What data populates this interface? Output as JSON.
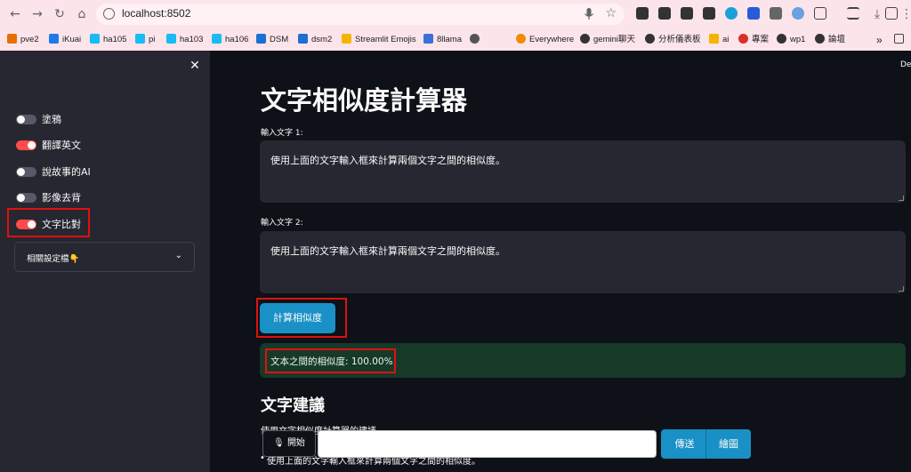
{
  "browser": {
    "url": "localhost:8502",
    "bookmarks": [
      {
        "label": "pve2",
        "color": "#e57000"
      },
      {
        "label": "iKuai",
        "color": "#1e7ae8"
      },
      {
        "label": "ha105",
        "color": "#18bcf2"
      },
      {
        "label": "pi",
        "color": "#18bcf2"
      },
      {
        "label": "ha103",
        "color": "#18bcf2"
      },
      {
        "label": "ha106",
        "color": "#18bcf2"
      },
      {
        "label": "DSM",
        "color": "#1c6fd4"
      },
      {
        "label": "dsm2",
        "color": "#1c6fd4"
      },
      {
        "label": "Streamlit Emojis",
        "color": "#f5b400"
      },
      {
        "label": "8llama",
        "color": "#3b6fd9"
      },
      {
        "label": "",
        "color": "#555555"
      },
      {
        "label": "Everywhere",
        "color": "#f28b00"
      },
      {
        "label": "gemini聊天",
        "color": "#333333"
      },
      {
        "label": "分析儀表板",
        "color": "#333333"
      },
      {
        "label": "ai",
        "color": "#f5b400"
      },
      {
        "label": "專案",
        "color": "#d93025"
      },
      {
        "label": "wp1",
        "color": "#333333"
      },
      {
        "label": "論壇",
        "color": "#333333"
      }
    ],
    "bookmarks_more": "»"
  },
  "sidebar": {
    "toggles": [
      {
        "label": "塗鴉",
        "on": false
      },
      {
        "label": "翻譯英文",
        "on": true
      },
      {
        "label": "說故事的AI",
        "on": false
      },
      {
        "label": "影像去背",
        "on": false
      },
      {
        "label": "文字比對",
        "on": true
      }
    ],
    "expander_label": "相關設定檔👇"
  },
  "main": {
    "deploy_label": "De",
    "title": "文字相似度計算器",
    "input1_label": "輸入文字 1:",
    "input1_value": "使用上面的文字輸入框來計算兩個文字之間的相似度。",
    "input2_label": "輸入文字 2:",
    "input2_value": "使用上面的文字輸入框來計算兩個文字之間的相似度。",
    "calc_button": "計算相似度",
    "result_text": "文本之間的相似度: 100.00%",
    "suggest_title": "文字建議",
    "suggest_para": "使用文字相似度計算器的建議",
    "suggest_bullet": "使用上面的文字輸入框來計算兩個文字之間的相似度。"
  },
  "bottom": {
    "start_label": "開始",
    "chat_placeholder": "",
    "send_label": "傳送",
    "draw_label": "繪圖"
  },
  "colors": {
    "accent": "#1a91c6",
    "toggle_on": "#ff4b4b",
    "highlight": "#e01010",
    "success_bg": "#173928"
  }
}
